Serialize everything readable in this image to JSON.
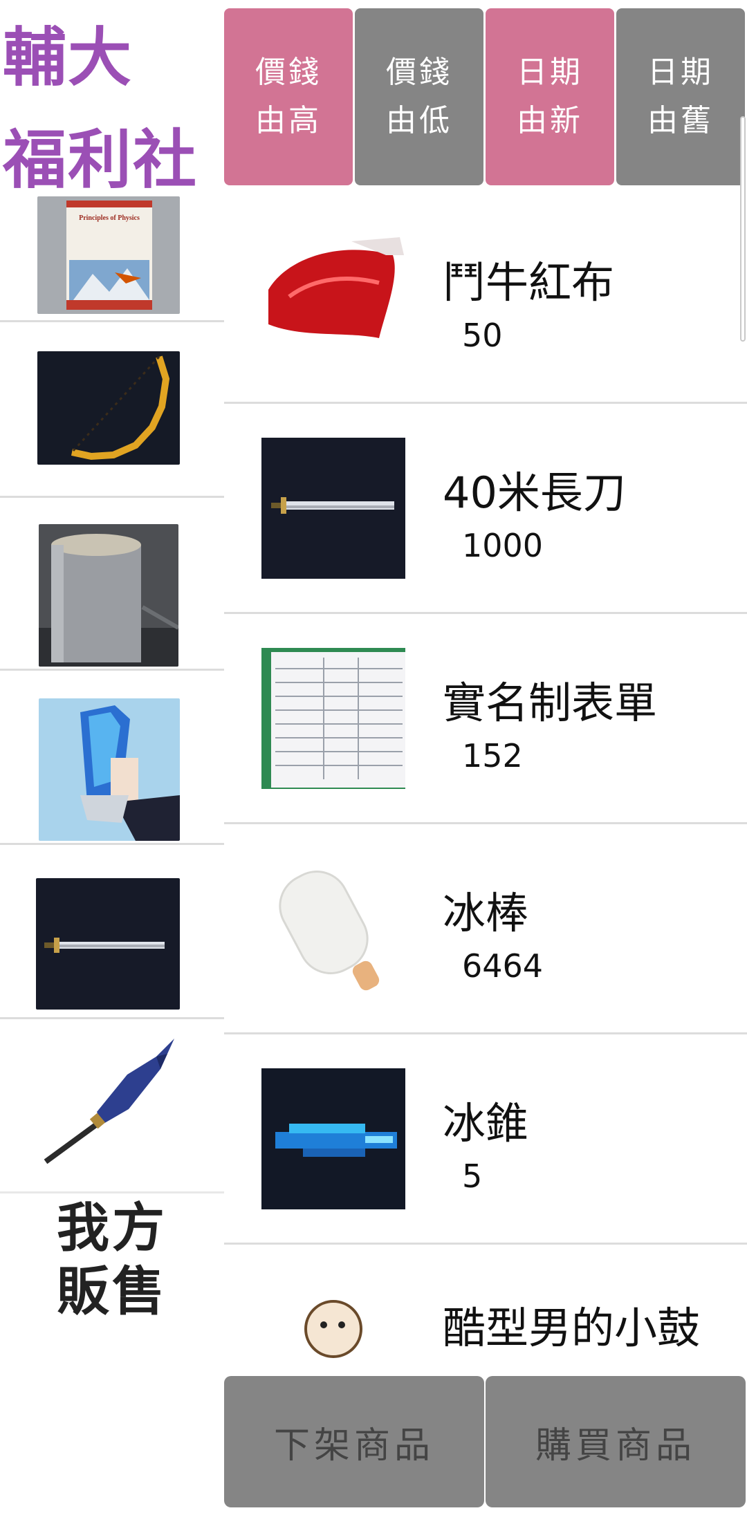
{
  "app": {
    "title_line1": "輔大",
    "title_line2": "福利社"
  },
  "sort_buttons": [
    {
      "line1": "價錢",
      "line2": "由高",
      "color": "#d27494"
    },
    {
      "line1": "價錢",
      "line2": "由低",
      "color": "#858585"
    },
    {
      "line1": "日期",
      "line2": "由新",
      "color": "#d27494"
    },
    {
      "line1": "日期",
      "line2": "由舊",
      "color": "#858585"
    }
  ],
  "sidebar": {
    "thumbnails": [
      {
        "icon": "physics-textbook-image",
        "text": "Principles of Physics"
      },
      {
        "icon": "pixel-bow-image"
      },
      {
        "icon": "metal-pot-image"
      },
      {
        "icon": "ice-crystal-hand-image"
      },
      {
        "icon": "pixel-sword-image"
      },
      {
        "icon": "buster-sword-image"
      }
    ],
    "own_sales_line1": "我方",
    "own_sales_line2": "販售"
  },
  "products": [
    {
      "name": "鬥牛紅布",
      "price": "50",
      "icon": "red-cloth-image"
    },
    {
      "name": "40米長刀",
      "price": "1000",
      "icon": "pixel-sword-image"
    },
    {
      "name": "實名制表單",
      "price": "152",
      "icon": "paper-form-image"
    },
    {
      "name": "冰棒",
      "price": "6464",
      "icon": "popsicle-image"
    },
    {
      "name": "冰錐",
      "price": "5",
      "icon": "pixel-ice-shard-image"
    },
    {
      "name": "酷型男的小鼓",
      "price": "",
      "icon": "cartoon-drum-image"
    }
  ],
  "actions": {
    "remove_label": "下架商品",
    "buy_label": "購買商品"
  },
  "colors": {
    "brand_purple": "#9b4fb5",
    "sort_active": "#d27494",
    "sort_inactive": "#858585",
    "action_button": "#858585"
  }
}
